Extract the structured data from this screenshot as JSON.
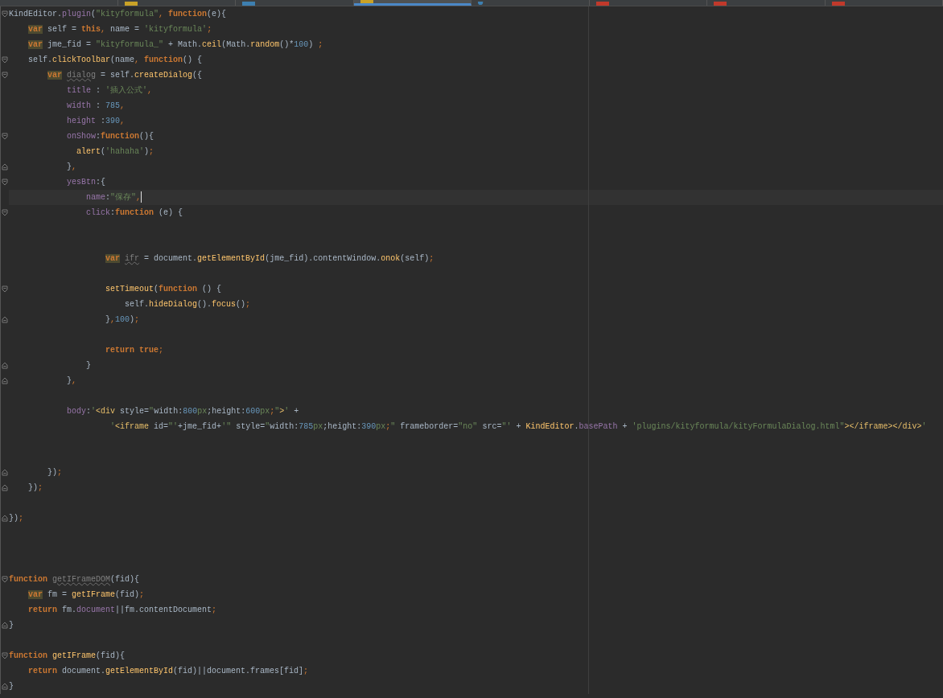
{
  "tabs": [
    {
      "kind": "plain",
      "selected": false
    },
    {
      "kind": "js",
      "selected": false
    },
    {
      "kind": "md",
      "selected": false
    },
    {
      "kind": "js",
      "selected": true
    },
    {
      "kind": "web",
      "selected": false
    },
    {
      "kind": "html",
      "selected": false
    },
    {
      "kind": "html",
      "selected": false
    },
    {
      "kind": "html",
      "selected": false
    }
  ],
  "editor": {
    "lines": [
      {
        "kind": "code",
        "current": false,
        "fold": {
          "kind": "start"
        },
        "tokens": [
          {
            "kind": "pl",
            "text": "KindEditor."
          },
          {
            "kind": "prop",
            "text": "plugin"
          },
          {
            "kind": "pl",
            "text": "("
          },
          {
            "kind": "str",
            "text": "\"kityformula\""
          },
          {
            "kind": "pu",
            "text": ", "
          },
          {
            "kind": "kw",
            "text": "function"
          },
          {
            "kind": "pl",
            "text": "(e){"
          }
        ]
      },
      {
        "kind": "code",
        "current": false,
        "tokens": [
          {
            "kind": "kwhl",
            "text": "    var"
          },
          {
            "kind": "pl",
            "text": " self = "
          },
          {
            "kind": "kw",
            "text": "this"
          },
          {
            "kind": "pu",
            "text": ", "
          },
          {
            "kind": "pl",
            "text": "name = "
          },
          {
            "kind": "str",
            "text": "'kityformula'"
          },
          {
            "kind": "pu",
            "text": ";"
          }
        ]
      },
      {
        "kind": "code",
        "current": false,
        "tokens": [
          {
            "kind": "kwhl",
            "text": "    var"
          },
          {
            "kind": "pl",
            "text": " jme_fid = "
          },
          {
            "kind": "str",
            "text": "\"kityformula_\""
          },
          {
            "kind": "pl",
            "text": " + Math."
          },
          {
            "kind": "fn",
            "text": "ceil"
          },
          {
            "kind": "pl",
            "text": "(Math."
          },
          {
            "kind": "fn",
            "text": "random"
          },
          {
            "kind": "pl",
            "text": "()*"
          },
          {
            "kind": "num",
            "text": "100"
          },
          {
            "kind": "pl",
            "text": ") "
          },
          {
            "kind": "pu",
            "text": ";"
          }
        ]
      },
      {
        "kind": "code",
        "current": false,
        "fold": {
          "kind": "start"
        },
        "tokens": [
          {
            "kind": "pl",
            "text": "    self."
          },
          {
            "kind": "fn",
            "text": "clickToolbar"
          },
          {
            "kind": "pl",
            "text": "(name"
          },
          {
            "kind": "pu",
            "text": ", "
          },
          {
            "kind": "kw",
            "text": "function"
          },
          {
            "kind": "pl",
            "text": "() {"
          }
        ]
      },
      {
        "kind": "code",
        "current": false,
        "fold": {
          "kind": "start"
        },
        "tokens": [
          {
            "kind": "kwhl",
            "text": "        var"
          },
          {
            "kind": "un",
            "text": " dialog"
          },
          {
            "kind": "pl",
            "text": " = self."
          },
          {
            "kind": "fn",
            "text": "createDialog"
          },
          {
            "kind": "pl",
            "text": "({"
          }
        ]
      },
      {
        "kind": "code",
        "current": false,
        "tokens": [
          {
            "kind": "prop",
            "text": "            title"
          },
          {
            "kind": "pl",
            "text": " : "
          },
          {
            "kind": "str",
            "text": "'插入公式'"
          },
          {
            "kind": "pu",
            "text": ","
          }
        ]
      },
      {
        "kind": "code",
        "current": false,
        "tokens": [
          {
            "kind": "prop",
            "text": "            width"
          },
          {
            "kind": "pl",
            "text": " : "
          },
          {
            "kind": "num",
            "text": "785"
          },
          {
            "kind": "pu",
            "text": ","
          }
        ]
      },
      {
        "kind": "code",
        "current": false,
        "tokens": [
          {
            "kind": "prop",
            "text": "            height"
          },
          {
            "kind": "pl",
            "text": " :"
          },
          {
            "kind": "num",
            "text": "390"
          },
          {
            "kind": "pu",
            "text": ","
          }
        ]
      },
      {
        "kind": "code",
        "current": false,
        "fold": {
          "kind": "start"
        },
        "tokens": [
          {
            "kind": "prop",
            "text": "            onShow"
          },
          {
            "kind": "pl",
            "text": ":"
          },
          {
            "kind": "kw",
            "text": "function"
          },
          {
            "kind": "pl",
            "text": "(){"
          }
        ]
      },
      {
        "kind": "code",
        "current": false,
        "tokens": [
          {
            "kind": "fn",
            "text": "              alert"
          },
          {
            "kind": "pl",
            "text": "("
          },
          {
            "kind": "str",
            "text": "'hahaha'"
          },
          {
            "kind": "pl",
            "text": ")"
          },
          {
            "kind": "pu",
            "text": ";"
          }
        ]
      },
      {
        "kind": "code",
        "current": false,
        "fold": {
          "kind": "end"
        },
        "tokens": [
          {
            "kind": "pl",
            "text": "            }"
          },
          {
            "kind": "pu",
            "text": ","
          }
        ]
      },
      {
        "kind": "code",
        "current": false,
        "fold": {
          "kind": "start"
        },
        "tokens": [
          {
            "kind": "prop",
            "text": "            yesBtn"
          },
          {
            "kind": "pl",
            "text": ":{"
          }
        ]
      },
      {
        "kind": "code",
        "current": true,
        "tokens": [
          {
            "kind": "prop",
            "text": "                name"
          },
          {
            "kind": "pl",
            "text": ":"
          },
          {
            "kind": "str",
            "text": "\"保存\""
          },
          {
            "kind": "pu",
            "text": ","
          }
        ]
      },
      {
        "kind": "code",
        "current": false,
        "fold": {
          "kind": "start"
        },
        "tokens": [
          {
            "kind": "prop",
            "text": "                click"
          },
          {
            "kind": "pl",
            "text": ":"
          },
          {
            "kind": "kw",
            "text": "function"
          },
          {
            "kind": "pl",
            "text": " (e) {"
          }
        ]
      },
      {
        "kind": "blank"
      },
      {
        "kind": "blank"
      },
      {
        "kind": "code",
        "current": false,
        "tokens": [
          {
            "kind": "kwhl",
            "text": "                    var"
          },
          {
            "kind": "un",
            "text": " ifr"
          },
          {
            "kind": "pl",
            "text": " = document."
          },
          {
            "kind": "fn",
            "text": "getElementById"
          },
          {
            "kind": "pl",
            "text": "(jme_fid).contentWindow."
          },
          {
            "kind": "fn",
            "text": "onok"
          },
          {
            "kind": "pl",
            "text": "(self)"
          },
          {
            "kind": "pu",
            "text": ";"
          }
        ]
      },
      {
        "kind": "blank"
      },
      {
        "kind": "code",
        "current": false,
        "fold": {
          "kind": "start"
        },
        "tokens": [
          {
            "kind": "fn",
            "text": "                    setTimeout"
          },
          {
            "kind": "pl",
            "text": "("
          },
          {
            "kind": "kw",
            "text": "function"
          },
          {
            "kind": "pl",
            "text": " () {"
          }
        ]
      },
      {
        "kind": "code",
        "current": false,
        "tokens": [
          {
            "kind": "pl",
            "text": "                        self."
          },
          {
            "kind": "fn",
            "text": "hideDialog"
          },
          {
            "kind": "pl",
            "text": "()."
          },
          {
            "kind": "fn",
            "text": "focus"
          },
          {
            "kind": "pl",
            "text": "()"
          },
          {
            "kind": "pu",
            "text": ";"
          }
        ]
      },
      {
        "kind": "code",
        "current": false,
        "fold": {
          "kind": "end"
        },
        "tokens": [
          {
            "kind": "pl",
            "text": "                    }"
          },
          {
            "kind": "pu",
            "text": ","
          },
          {
            "kind": "num",
            "text": "100"
          },
          {
            "kind": "pl",
            "text": ")"
          },
          {
            "kind": "pu",
            "text": ";"
          }
        ]
      },
      {
        "kind": "blank"
      },
      {
        "kind": "code",
        "current": false,
        "tokens": [
          {
            "kind": "kw",
            "text": "                    return true"
          },
          {
            "kind": "pu",
            "text": ";"
          }
        ]
      },
      {
        "kind": "code",
        "current": false,
        "fold": {
          "kind": "end"
        },
        "tokens": [
          {
            "kind": "pl",
            "text": "                }"
          }
        ]
      },
      {
        "kind": "code",
        "current": false,
        "fold": {
          "kind": "end"
        },
        "tokens": [
          {
            "kind": "pl",
            "text": "            }"
          },
          {
            "kind": "pu",
            "text": ","
          }
        ]
      },
      {
        "kind": "blank"
      },
      {
        "kind": "code",
        "current": false,
        "tokens": [
          {
            "kind": "prop",
            "text": "            body"
          },
          {
            "kind": "pl",
            "text": ":"
          },
          {
            "kind": "str",
            "text": "'"
          },
          {
            "kind": "tag",
            "text": "<div"
          },
          {
            "kind": "pl",
            "text": " style="
          },
          {
            "kind": "str",
            "text": "\""
          },
          {
            "kind": "pl",
            "text": "width:"
          },
          {
            "kind": "num",
            "text": "800"
          },
          {
            "kind": "str",
            "text": "px"
          },
          {
            "kind": "pl",
            "text": ";height:"
          },
          {
            "kind": "num",
            "text": "600"
          },
          {
            "kind": "str",
            "text": "px"
          },
          {
            "kind": "pu",
            "text": ";"
          },
          {
            "kind": "str",
            "text": "\""
          },
          {
            "kind": "tag",
            "text": ">"
          },
          {
            "kind": "str",
            "text": "'"
          },
          {
            "kind": "pl",
            "text": " +"
          }
        ]
      },
      {
        "kind": "code",
        "current": false,
        "tokens": [
          {
            "kind": "str",
            "text": "                     '"
          },
          {
            "kind": "tag",
            "text": "<iframe"
          },
          {
            "kind": "pl",
            "text": " id="
          },
          {
            "kind": "str",
            "text": "\"'"
          },
          {
            "kind": "pl",
            "text": "+jme_fid+"
          },
          {
            "kind": "str",
            "text": "'\""
          },
          {
            "kind": "pl",
            "text": " style="
          },
          {
            "kind": "str",
            "text": "\""
          },
          {
            "kind": "pl",
            "text": "width:"
          },
          {
            "kind": "num",
            "text": "785"
          },
          {
            "kind": "str",
            "text": "px"
          },
          {
            "kind": "pl",
            "text": ";height:"
          },
          {
            "kind": "num",
            "text": "390"
          },
          {
            "kind": "str",
            "text": "px"
          },
          {
            "kind": "pu",
            "text": ";"
          },
          {
            "kind": "str",
            "text": "\""
          },
          {
            "kind": "pl",
            "text": " frameborder="
          },
          {
            "kind": "str",
            "text": "\"no\""
          },
          {
            "kind": "pl",
            "text": " src="
          },
          {
            "kind": "str",
            "text": "\"'"
          },
          {
            "kind": "pl",
            "text": " + "
          },
          {
            "kind": "fn",
            "text": "KindEditor"
          },
          {
            "kind": "pl",
            "text": "."
          },
          {
            "kind": "prop",
            "text": "basePath"
          },
          {
            "kind": "pl",
            "text": " + "
          },
          {
            "kind": "str",
            "text": "'plugins/kityformula/kityFormulaDialog.html\""
          },
          {
            "kind": "tag",
            "text": "></iframe></div>"
          },
          {
            "kind": "str",
            "text": "'"
          }
        ]
      },
      {
        "kind": "blank"
      },
      {
        "kind": "blank"
      },
      {
        "kind": "code",
        "current": false,
        "fold": {
          "kind": "end"
        },
        "tokens": [
          {
            "kind": "pl",
            "text": "        })"
          },
          {
            "kind": "pu",
            "text": ";"
          }
        ]
      },
      {
        "kind": "code",
        "current": false,
        "fold": {
          "kind": "end"
        },
        "tokens": [
          {
            "kind": "pl",
            "text": "    })"
          },
          {
            "kind": "pu",
            "text": ";"
          }
        ]
      },
      {
        "kind": "blank"
      },
      {
        "kind": "code",
        "current": false,
        "fold": {
          "kind": "end"
        },
        "tokens": [
          {
            "kind": "pl",
            "text": "})"
          },
          {
            "kind": "pu",
            "text": ";"
          }
        ]
      },
      {
        "kind": "blank"
      },
      {
        "kind": "blank"
      },
      {
        "kind": "blank"
      },
      {
        "kind": "code",
        "current": false,
        "fold": {
          "kind": "start"
        },
        "tokens": [
          {
            "kind": "kw",
            "text": "function"
          },
          {
            "kind": "un",
            "text": " getIFrameDOM"
          },
          {
            "kind": "pl",
            "text": "(fid){"
          }
        ]
      },
      {
        "kind": "code",
        "current": false,
        "tokens": [
          {
            "kind": "kwhl",
            "text": "    var"
          },
          {
            "kind": "pl",
            "text": " fm = "
          },
          {
            "kind": "fn",
            "text": "getIFrame"
          },
          {
            "kind": "pl",
            "text": "(fid)"
          },
          {
            "kind": "pu",
            "text": ";"
          }
        ]
      },
      {
        "kind": "code",
        "current": false,
        "tokens": [
          {
            "kind": "kw",
            "text": "    return"
          },
          {
            "kind": "pl",
            "text": " fm."
          },
          {
            "kind": "prop",
            "text": "document"
          },
          {
            "kind": "pl",
            "text": "||fm.contentDocument"
          },
          {
            "kind": "pu",
            "text": ";"
          }
        ]
      },
      {
        "kind": "code",
        "current": false,
        "fold": {
          "kind": "end"
        },
        "tokens": [
          {
            "kind": "pl",
            "text": "}"
          }
        ]
      },
      {
        "kind": "blank"
      },
      {
        "kind": "code",
        "current": false,
        "fold": {
          "kind": "start"
        },
        "tokens": [
          {
            "kind": "kw",
            "text": "function"
          },
          {
            "kind": "fn",
            "text": " getIFrame"
          },
          {
            "kind": "pl",
            "text": "(fid){"
          }
        ]
      },
      {
        "kind": "code",
        "current": false,
        "tokens": [
          {
            "kind": "kw",
            "text": "    return"
          },
          {
            "kind": "pl",
            "text": " document."
          },
          {
            "kind": "fn",
            "text": "getElementById"
          },
          {
            "kind": "pl",
            "text": "(fid)||document.frames[fid]"
          },
          {
            "kind": "pu",
            "text": ";"
          }
        ]
      },
      {
        "kind": "code",
        "current": false,
        "fold": {
          "kind": "end"
        },
        "tokens": [
          {
            "kind": "pl",
            "text": "}"
          }
        ]
      }
    ]
  }
}
